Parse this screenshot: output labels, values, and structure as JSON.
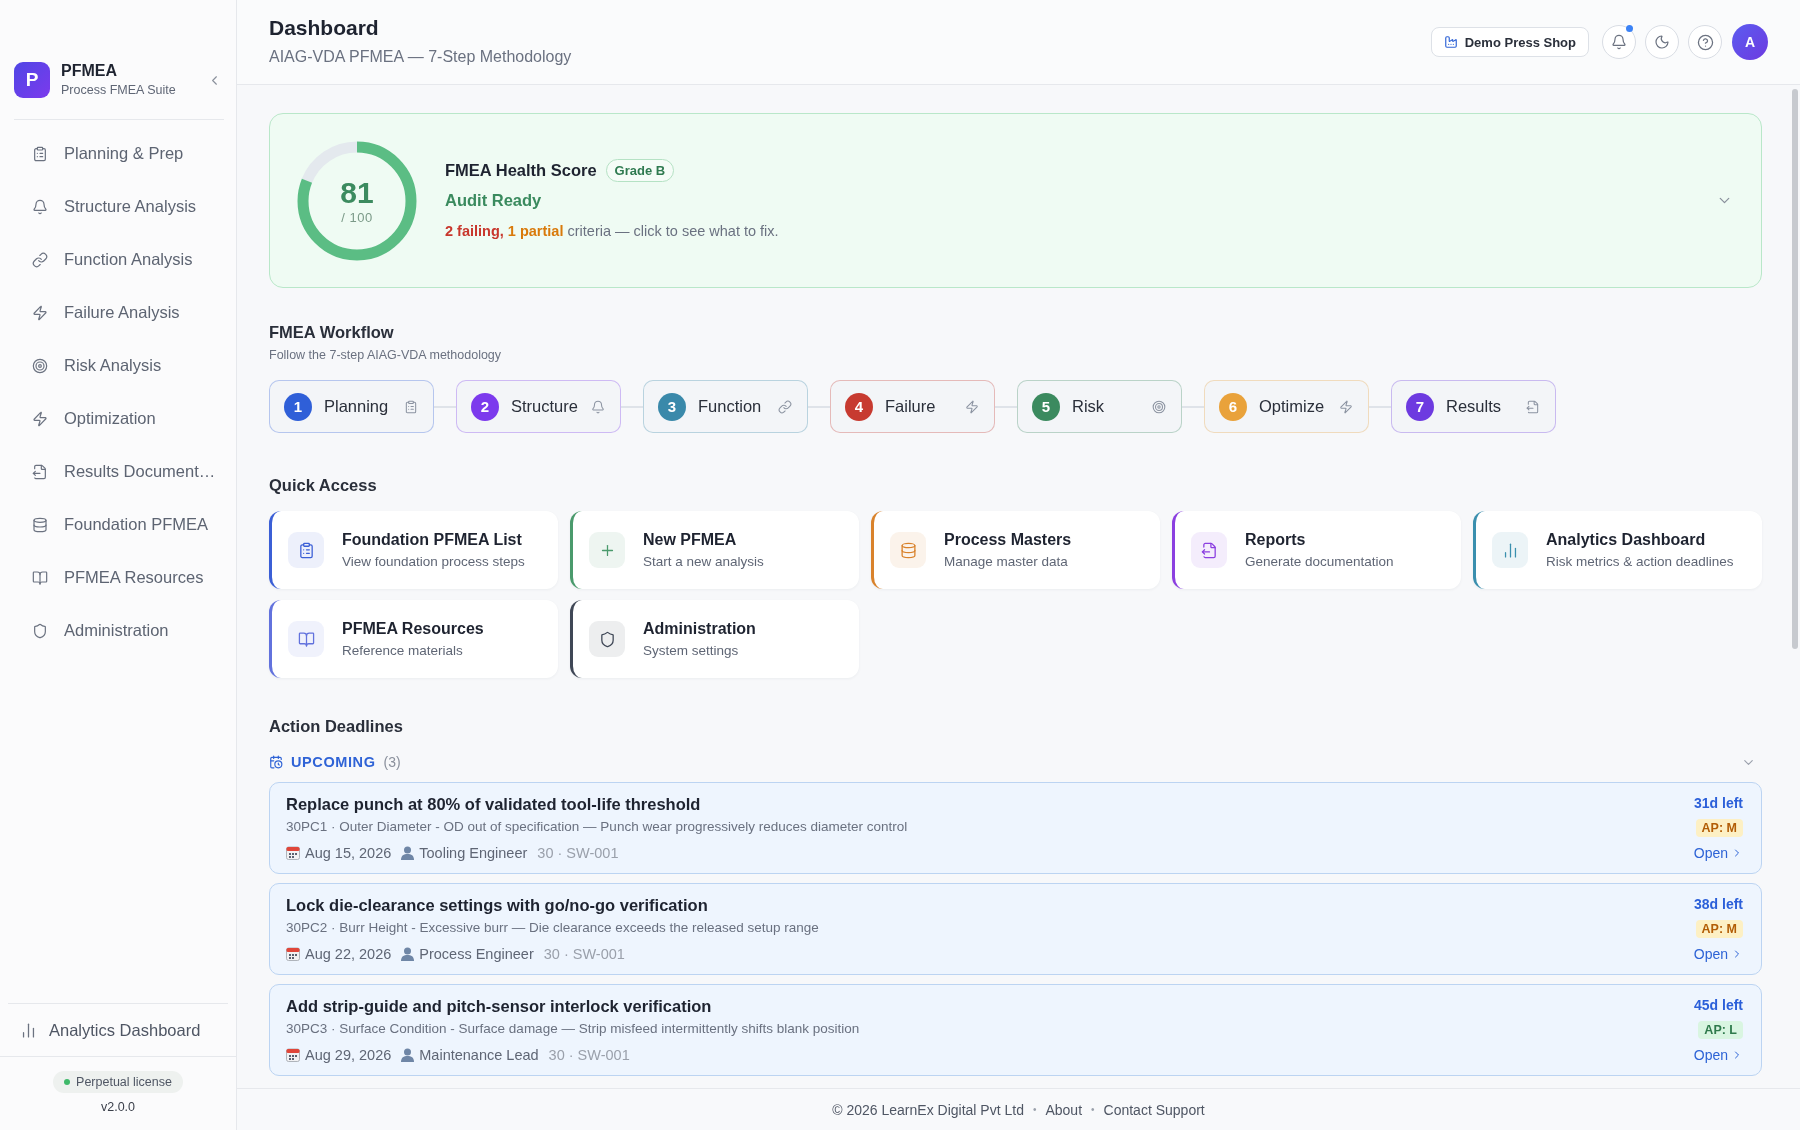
{
  "sidebar": {
    "logo": {
      "letter": "P",
      "title": "PFMEA",
      "subtitle": "Process FMEA Suite"
    },
    "items": [
      {
        "label": "Planning & Prep",
        "selected": false
      },
      {
        "label": "Structure Analysis",
        "selected": false
      },
      {
        "label": "Function Analysis",
        "selected": false
      },
      {
        "label": "Failure Analysis",
        "selected": false
      },
      {
        "label": "Risk Analysis",
        "selected": false
      },
      {
        "label": "Optimization",
        "selected": false
      },
      {
        "label": "Results Document…",
        "selected": false
      },
      {
        "label": "Foundation PFMEA",
        "selected": false
      },
      {
        "label": "PFMEA Resources",
        "selected": false
      },
      {
        "label": "Administration",
        "selected": false
      }
    ],
    "footer_link": {
      "label": "Analytics Dashboard"
    },
    "license": {
      "label": "Perpetual license"
    },
    "version": "v2.0.0"
  },
  "header": {
    "title": "Dashboard",
    "subtitle": "AIAG-VDA PFMEA — 7-Step Methodology",
    "plant_button": "Demo Press Shop",
    "notifications_unread": true,
    "avatar_letter": "A"
  },
  "health": {
    "score": "81",
    "max": "/ 100",
    "level": 0.81,
    "title": "FMEA Health Score",
    "grade": "Grade B",
    "status": "Audit Ready",
    "summary": [
      {
        "text": "2 failing,",
        "kind": "failing"
      },
      {
        "text": " 1 partial",
        "kind": "partial"
      },
      {
        "text": " criteria — click to see what to fix.",
        "kind": "plain"
      }
    ],
    "expanded": false
  },
  "workflow": {
    "title": "FMEA Workflow",
    "subtitle": "Follow the 7-step AIAG-VDA methodology",
    "steps": [
      {
        "number": "1",
        "label": "Planning",
        "color": "#2f5fd8"
      },
      {
        "number": "2",
        "label": "Structure",
        "color": "#7c3aed"
      },
      {
        "number": "3",
        "label": "Function",
        "color": "#3a89aa"
      },
      {
        "number": "4",
        "label": "Failure",
        "color": "#c73a30"
      },
      {
        "number": "5",
        "label": "Risk",
        "color": "#3b8a5f"
      },
      {
        "number": "6",
        "label": "Optimize",
        "color": "#e9a23b"
      },
      {
        "number": "7",
        "label": "Results",
        "color": "#6d3ae0"
      }
    ]
  },
  "quick_access": {
    "title": "Quick Access",
    "items": [
      {
        "title": "Foundation PFMEA List",
        "subtitle": "View foundation process steps",
        "color": "#3b5fd6"
      },
      {
        "title": "New PFMEA",
        "subtitle": "Start a new analysis",
        "color": "#4a9a6c"
      },
      {
        "title": "Process Masters",
        "subtitle": "Manage master data",
        "color": "#d9822b"
      },
      {
        "title": "Reports",
        "subtitle": "Generate documentation",
        "color": "#8b3fe0"
      },
      {
        "title": "Analytics Dashboard",
        "subtitle": "Risk metrics & action deadlines",
        "color": "#3a8fae"
      },
      {
        "title": "PFMEA Resources",
        "subtitle": "Reference materials",
        "color": "#6272dd"
      },
      {
        "title": "Administration",
        "subtitle": "System settings",
        "color": "#3f4756"
      }
    ]
  },
  "deadlines": {
    "title": "Action Deadlines",
    "group": {
      "label": "UPCOMING",
      "count": "(3)",
      "expanded": true
    },
    "items": [
      {
        "title": "Replace punch at 80% of validated tool-life threshold",
        "detail": "30PC1 · Outer Diameter - OD out of specification — Punch wear progressively reduces diameter control",
        "date": "Aug 15, 2026",
        "owner": "Tooling Engineer",
        "ref": "30 · SW-001",
        "remaining": "31d left",
        "ap": {
          "text": "AP: M",
          "kind": "medium"
        },
        "link": "Open"
      },
      {
        "title": "Lock die-clearance settings with go/no-go verification",
        "detail": "30PC2 · Burr Height - Excessive burr — Die clearance exceeds the released setup range",
        "date": "Aug 22, 2026",
        "owner": "Process Engineer",
        "ref": "30 · SW-001",
        "remaining": "38d left",
        "ap": {
          "text": "AP: M",
          "kind": "medium"
        },
        "link": "Open"
      },
      {
        "title": "Add strip-guide and pitch-sensor interlock verification",
        "detail": "30PC3 · Surface Condition - Surface damage — Strip misfeed intermittently shifts blank position",
        "date": "Aug 29, 2026",
        "owner": "Maintenance Lead",
        "ref": "30 · SW-001",
        "remaining": "45d left",
        "ap": {
          "text": "AP: L",
          "kind": "low"
        },
        "link": "Open"
      }
    ]
  },
  "footer": {
    "copyright": "© 2026 LearnEx Digital Pvt Ltd",
    "links": [
      "About",
      "Contact Support"
    ],
    "separator": "•"
  }
}
